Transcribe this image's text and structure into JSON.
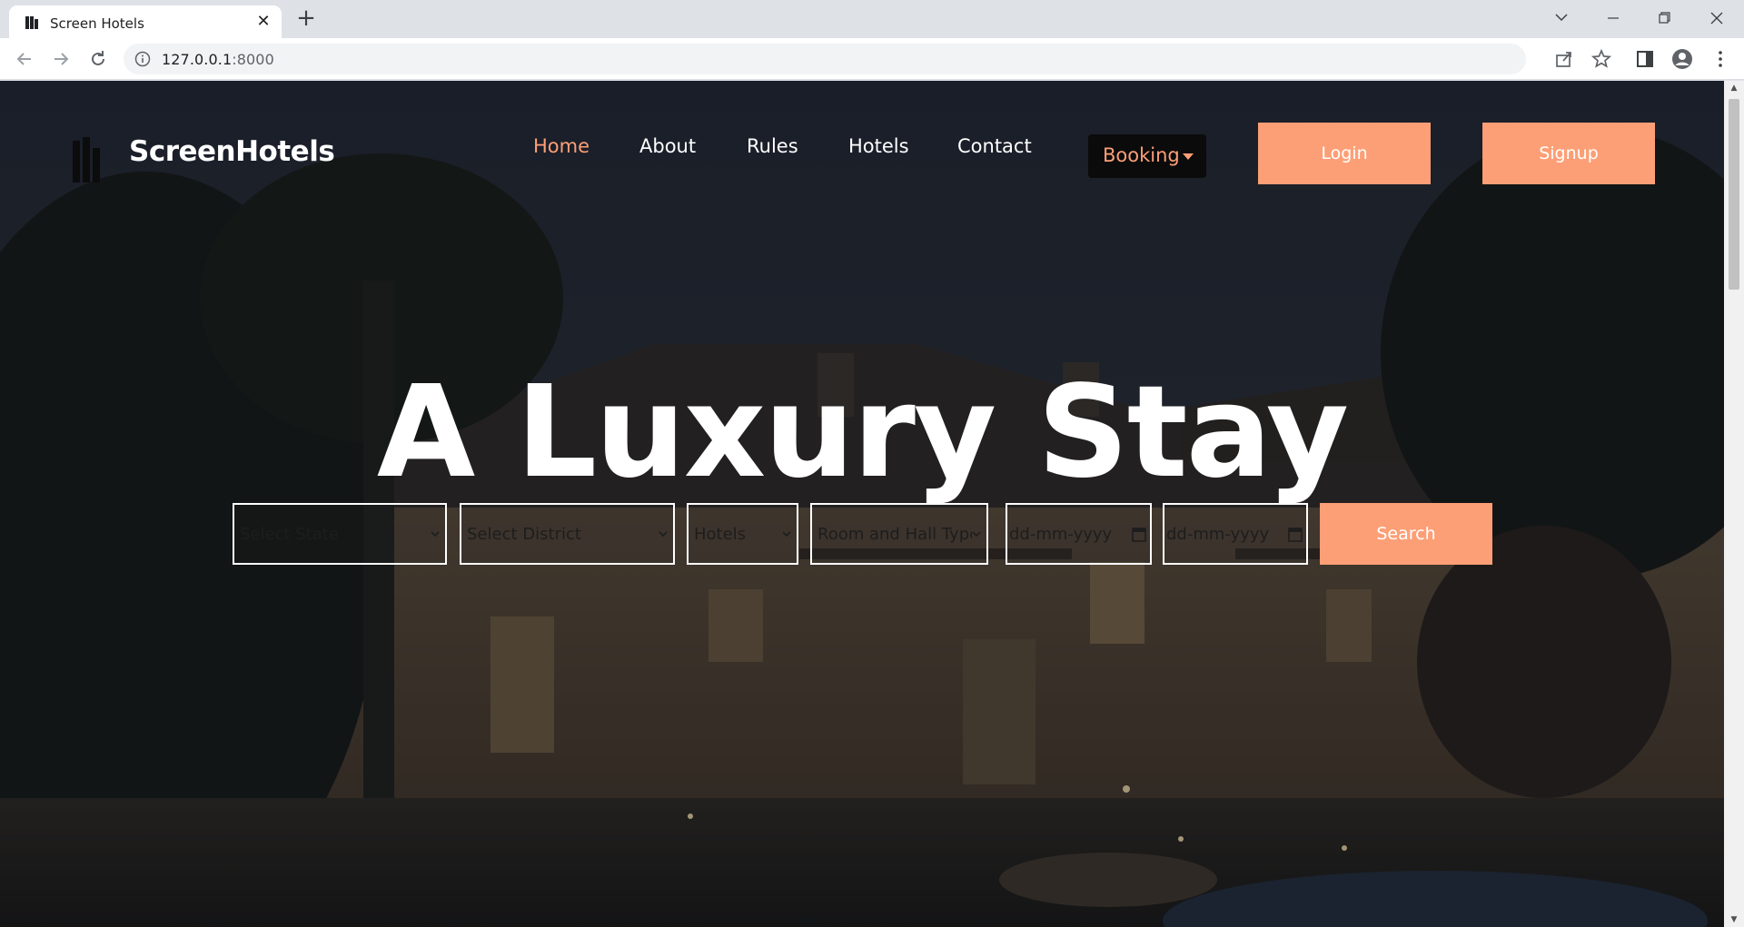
{
  "browser": {
    "tab_title": "Screen Hotels",
    "url_host": "127.0.0.1",
    "url_port": ":8000"
  },
  "site": {
    "brand": "ScreenHotels",
    "nav": {
      "home": "Home",
      "about": "About",
      "rules": "Rules",
      "hotels": "Hotels",
      "contact": "Contact"
    },
    "booking_label": "Booking",
    "login_label": "Login",
    "signup_label": "Signup"
  },
  "hero": {
    "title": "A Luxury Stay"
  },
  "search": {
    "state": "Select State",
    "district": "Select District",
    "hotels": "Hotels",
    "room_type": "Room and Hall Type",
    "checkin": "dd-mm-yyyy",
    "checkout": "dd-mm-yyyy",
    "button": "Search"
  },
  "colors": {
    "accent": "#fd9f76",
    "booking_bg": "#0b0b0c",
    "text": "#ffffff"
  }
}
